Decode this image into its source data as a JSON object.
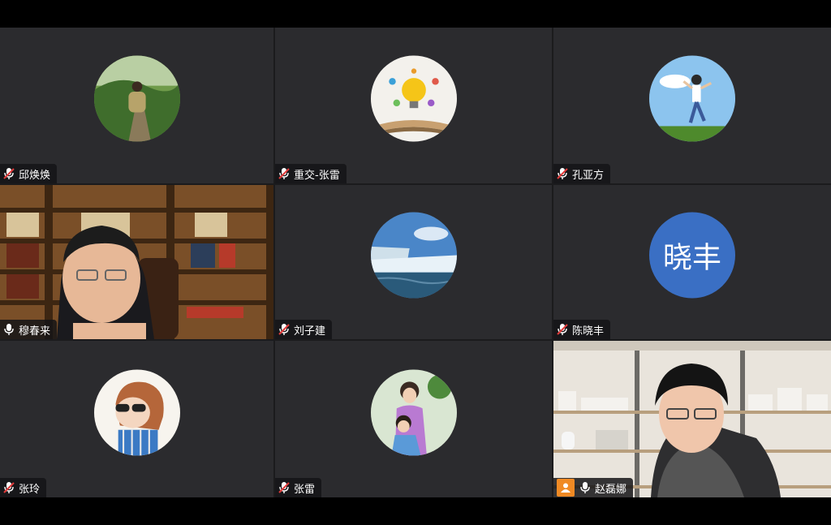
{
  "participants": [
    {
      "name": "邱焕焕",
      "mic": "muted",
      "avatar": "photo-hiker-icon"
    },
    {
      "name": "重交-张雷",
      "mic": "muted",
      "avatar": "lightbulb-books-icon"
    },
    {
      "name": "孔亚方",
      "mic": "muted",
      "avatar": "child-jumping-icon"
    },
    {
      "name": "穆春来",
      "mic": "on",
      "avatar": "video-feed",
      "active_speaker": true
    },
    {
      "name": "刘子建",
      "mic": "muted",
      "avatar": "waterfall-icon"
    },
    {
      "name": "陈晓丰",
      "mic": "muted",
      "avatar_text": "晓丰"
    },
    {
      "name": "张玲",
      "mic": "muted",
      "avatar": "cartoon-girl-icon"
    },
    {
      "name": "张雷",
      "mic": "muted",
      "avatar": "mother-child-icon"
    },
    {
      "name": "赵磊娜",
      "mic": "on",
      "avatar": "video-feed",
      "sharing": true
    }
  ],
  "colors": {
    "active_border": "#23c552",
    "text_avatar_bg": "#3a6fc4",
    "mute_red": "#e23b3b",
    "share_orange": "#f08a24"
  }
}
